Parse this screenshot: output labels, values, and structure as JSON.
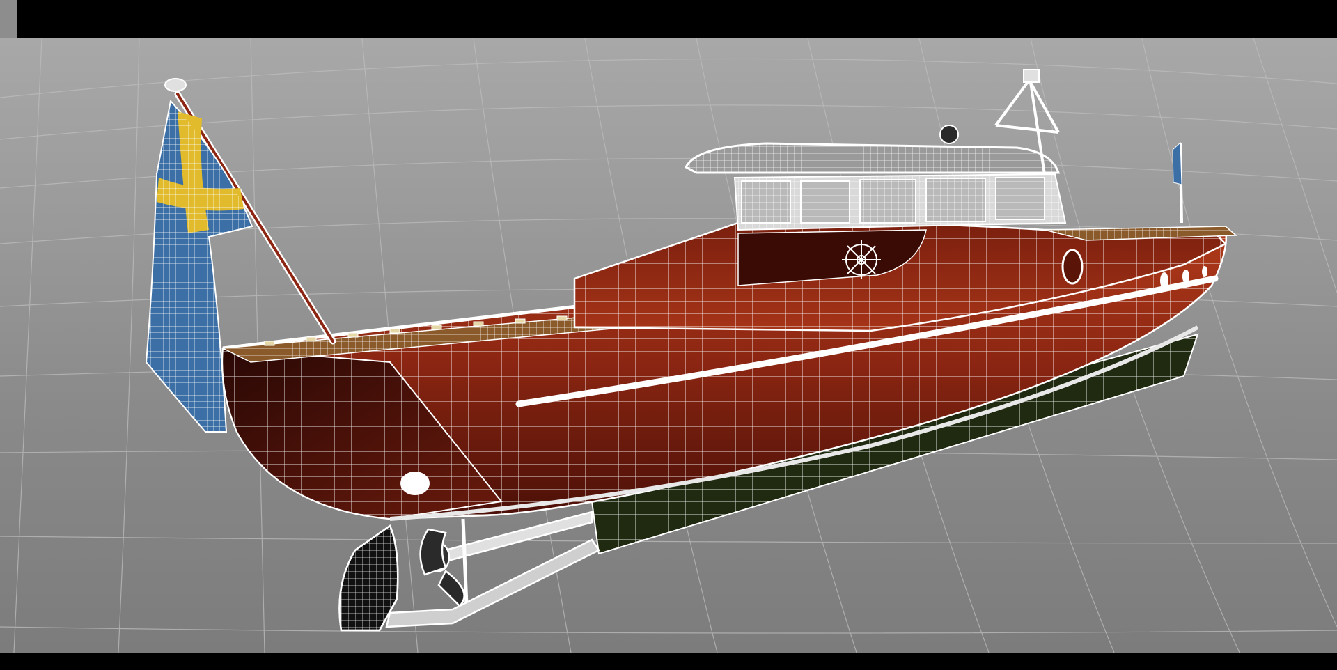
{
  "app": {
    "viewport_label": ""
  },
  "scene": {
    "subject": "wireframe-boat-model",
    "flag_colors": {
      "blue": "#3b6fa5",
      "yellow": "#e2bb2c"
    },
    "hull_color": "#8c2612",
    "hull_bottom_color": "#1f2a10",
    "wire_color": "#ffffff",
    "grid_color": "#bdbdbd"
  }
}
